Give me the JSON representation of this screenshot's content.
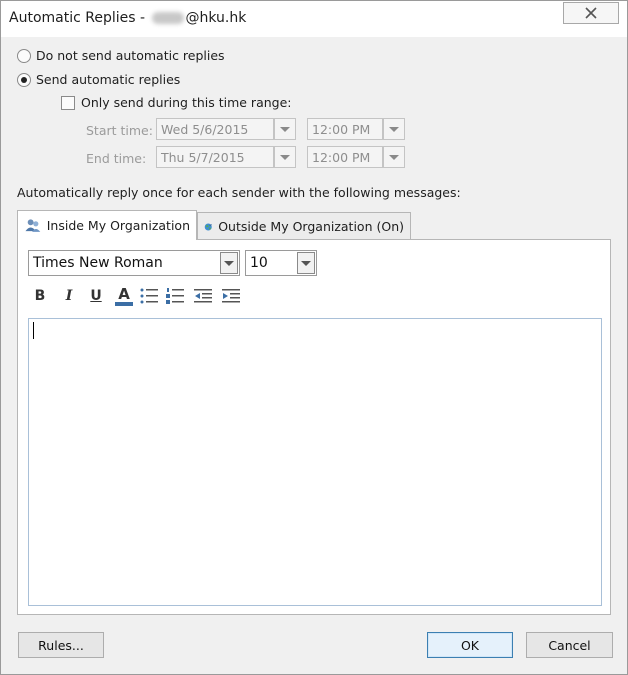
{
  "window": {
    "title_prefix": "Automatic Replies -",
    "title_suffix": "@hku.hk"
  },
  "options": {
    "do_not_send_label": "Do not send automatic replies",
    "send_label": "Send automatic replies",
    "selected": "send",
    "time_range_label": "Only send during this time range:",
    "time_range_checked": false,
    "start_label": "Start time:",
    "start_date": "Wed 5/6/2015",
    "start_time": "12:00 PM",
    "end_label": "End time:",
    "end_date": "Thu 5/7/2015",
    "end_time": "12:00 PM"
  },
  "instructions": "Automatically reply once for each sender with the following messages:",
  "tabs": [
    {
      "label": "Inside My Organization",
      "active": true,
      "icon": "people-icon"
    },
    {
      "label": "Outside My Organization (On)",
      "active": false,
      "icon": "globe-icon"
    }
  ],
  "toolbar": {
    "font_name": "Times New Roman",
    "font_size": "10",
    "bold": "B",
    "italic": "I",
    "underline": "U",
    "font_color": "A",
    "font_color_bar": "#3b6ea5"
  },
  "editor": {
    "content": ""
  },
  "buttons": {
    "rules": "Rules...",
    "ok": "OK",
    "cancel": "Cancel"
  }
}
